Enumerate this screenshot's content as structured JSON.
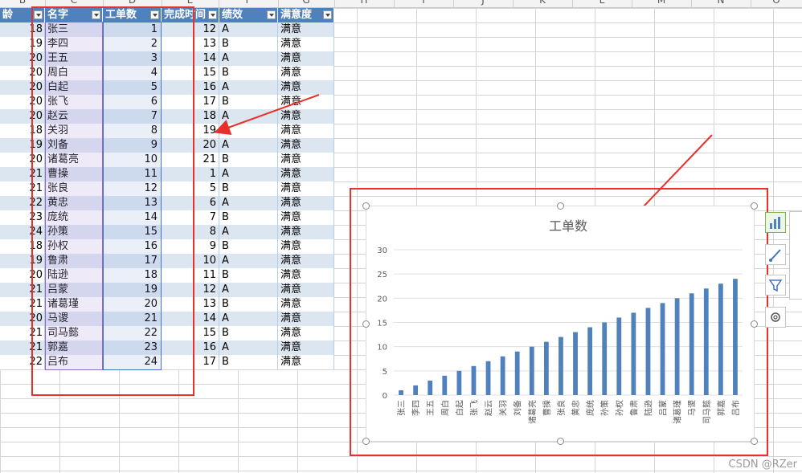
{
  "column_letters": [
    "B",
    "C",
    "D",
    "E",
    "F",
    "G",
    "H",
    "I",
    "J",
    "K",
    "L",
    "M",
    "N",
    "O"
  ],
  "table": {
    "headers": [
      "龄",
      "名字",
      "工单数",
      "完成时间",
      "绩效",
      "满意度"
    ],
    "rows": [
      {
        "age": "18",
        "name": "张三",
        "count": "1",
        "time": "12",
        "grade": "A",
        "sat": "满意"
      },
      {
        "age": "19",
        "name": "李四",
        "count": "2",
        "time": "13",
        "grade": "B",
        "sat": "满意"
      },
      {
        "age": "20",
        "name": "王五",
        "count": "3",
        "time": "14",
        "grade": "A",
        "sat": "满意"
      },
      {
        "age": "20",
        "name": "周白",
        "count": "4",
        "time": "15",
        "grade": "B",
        "sat": "满意"
      },
      {
        "age": "20",
        "name": "白起",
        "count": "5",
        "time": "16",
        "grade": "A",
        "sat": "满意"
      },
      {
        "age": "20",
        "name": "张飞",
        "count": "6",
        "time": "17",
        "grade": "B",
        "sat": "满意"
      },
      {
        "age": "20",
        "name": "赵云",
        "count": "7",
        "time": "18",
        "grade": "A",
        "sat": "满意"
      },
      {
        "age": "18",
        "name": "关羽",
        "count": "8",
        "time": "19",
        "grade": "B",
        "sat": "满意"
      },
      {
        "age": "19",
        "name": "刘备",
        "count": "9",
        "time": "20",
        "grade": "A",
        "sat": "满意"
      },
      {
        "age": "20",
        "name": "诸葛亮",
        "count": "10",
        "time": "21",
        "grade": "B",
        "sat": "满意"
      },
      {
        "age": "21",
        "name": "曹操",
        "count": "11",
        "time": "1",
        "grade": "A",
        "sat": "满意"
      },
      {
        "age": "21",
        "name": "张良",
        "count": "12",
        "time": "5",
        "grade": "B",
        "sat": "满意"
      },
      {
        "age": "22",
        "name": "黄忠",
        "count": "13",
        "time": "6",
        "grade": "A",
        "sat": "满意"
      },
      {
        "age": "23",
        "name": "庞统",
        "count": "14",
        "time": "7",
        "grade": "B",
        "sat": "满意"
      },
      {
        "age": "24",
        "name": "孙策",
        "count": "15",
        "time": "8",
        "grade": "A",
        "sat": "满意"
      },
      {
        "age": "18",
        "name": "孙权",
        "count": "16",
        "time": "9",
        "grade": "B",
        "sat": "满意"
      },
      {
        "age": "19",
        "name": "鲁肃",
        "count": "17",
        "time": "10",
        "grade": "A",
        "sat": "满意"
      },
      {
        "age": "20",
        "name": "陆逊",
        "count": "18",
        "time": "11",
        "grade": "B",
        "sat": "满意"
      },
      {
        "age": "21",
        "name": "吕蒙",
        "count": "19",
        "time": "12",
        "grade": "A",
        "sat": "满意"
      },
      {
        "age": "21",
        "name": "诸葛瑾",
        "count": "20",
        "time": "13",
        "grade": "B",
        "sat": "满意"
      },
      {
        "age": "20",
        "name": "马谡",
        "count": "21",
        "time": "14",
        "grade": "A",
        "sat": "满意"
      },
      {
        "age": "21",
        "name": "司马懿",
        "count": "22",
        "time": "15",
        "grade": "B",
        "sat": "满意"
      },
      {
        "age": "21",
        "name": "郭嘉",
        "count": "23",
        "time": "16",
        "grade": "A",
        "sat": "满意"
      },
      {
        "age": "22",
        "name": "吕布",
        "count": "24",
        "time": "17",
        "grade": "B",
        "sat": "满意"
      }
    ]
  },
  "chart_data": {
    "type": "bar",
    "title": "工单数",
    "categories": [
      "张三",
      "李四",
      "王五",
      "周白",
      "白起",
      "张飞",
      "赵云",
      "关羽",
      "刘备",
      "诸葛亮",
      "曹操",
      "张良",
      "黄忠",
      "庞统",
      "孙策",
      "孙权",
      "鲁肃",
      "陆逊",
      "吕蒙",
      "诸葛瑾",
      "马谡",
      "司马懿",
      "郭嘉",
      "吕布"
    ],
    "values": [
      1,
      2,
      3,
      4,
      5,
      6,
      7,
      8,
      9,
      10,
      11,
      12,
      13,
      14,
      15,
      16,
      17,
      18,
      19,
      20,
      21,
      22,
      23,
      24
    ],
    "yticks": [
      "0",
      "5",
      "10",
      "15",
      "20",
      "25",
      "30"
    ],
    "ylim": [
      0,
      30
    ],
    "grid": true,
    "bar_color": "#4f81bd"
  },
  "side_buttons": [
    "chart-elements-icon",
    "chart-styles-icon",
    "chart-filter-icon",
    "chart-settings-icon"
  ],
  "watermark": "CSDN @RZer",
  "colors": {
    "annotation": "#e8312a",
    "header": "#4f81bd",
    "band": "#dce6f1"
  }
}
